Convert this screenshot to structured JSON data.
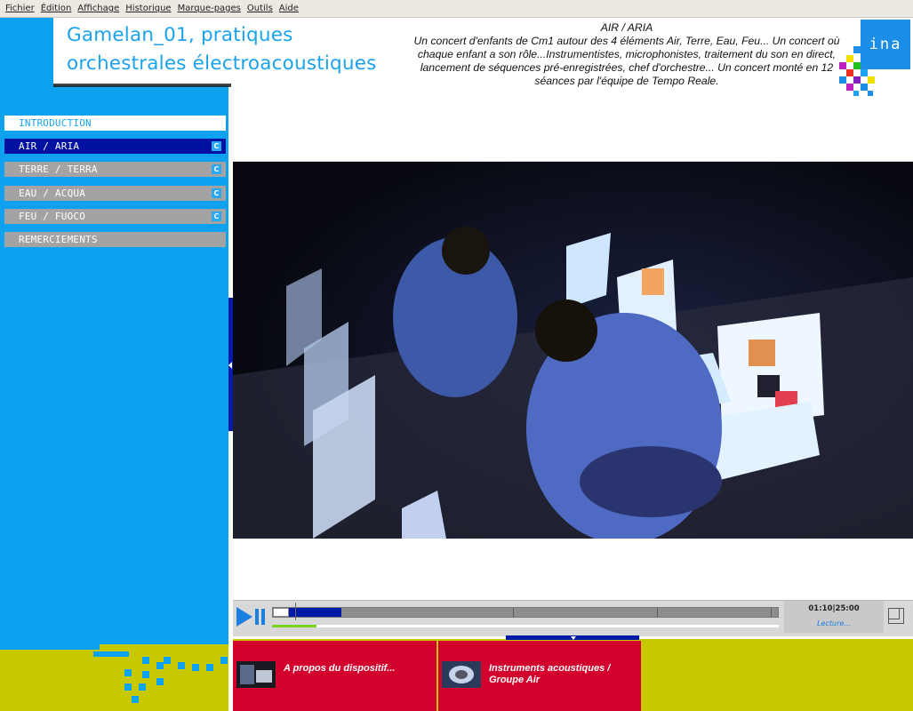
{
  "menu": [
    "Fichier",
    "Édition",
    "Affichage",
    "Historique",
    "Marque-pages",
    "Outils",
    "Aide"
  ],
  "header": {
    "title_line1": "Gamelan_01, pratiques",
    "title_line2": "orchestrales électroacoustiques",
    "section_title": "AIR / ARIA",
    "description": "Un concert d'enfants de Cm1 autour des 4 éléments Air, Terre, Eau, Feu... Un concert où chaque enfant a son rôle...Instrumentistes, microphonistes, traitement du son en direct, lancement de séquences pré-enregistrées, chef d'orchestre... Un concert monté en 12 séances par l'équipe de Tempo Reale.",
    "logo_text": "ina"
  },
  "nav": [
    {
      "label": "INTRODUCTION",
      "state": "active",
      "icon": ""
    },
    {
      "label": "AIR / ARIA",
      "state": "current",
      "icon": "C"
    },
    {
      "label": "TERRE / TERRA",
      "state": "normal",
      "icon": "C"
    },
    {
      "label": "EAU / ACQUA",
      "state": "normal",
      "icon": "C"
    },
    {
      "label": "FEU / FUOCO",
      "state": "normal",
      "icon": "C"
    },
    {
      "label": "REMERCIEMENTS",
      "state": "normal",
      "icon": ""
    }
  ],
  "player": {
    "time": "01:10|25:00",
    "status": "Lecture...",
    "progress": 0.047
  },
  "cards": [
    {
      "label_line1": "A propos du dispositif...",
      "label_line2": ""
    },
    {
      "label_line1": "Instruments acoustiques /",
      "label_line2": "Groupe Air"
    }
  ],
  "colors": {
    "accent": "#0ea1f0",
    "dark_blue": "#001aa8",
    "red": "#d3002d",
    "olive": "#c8c800"
  }
}
